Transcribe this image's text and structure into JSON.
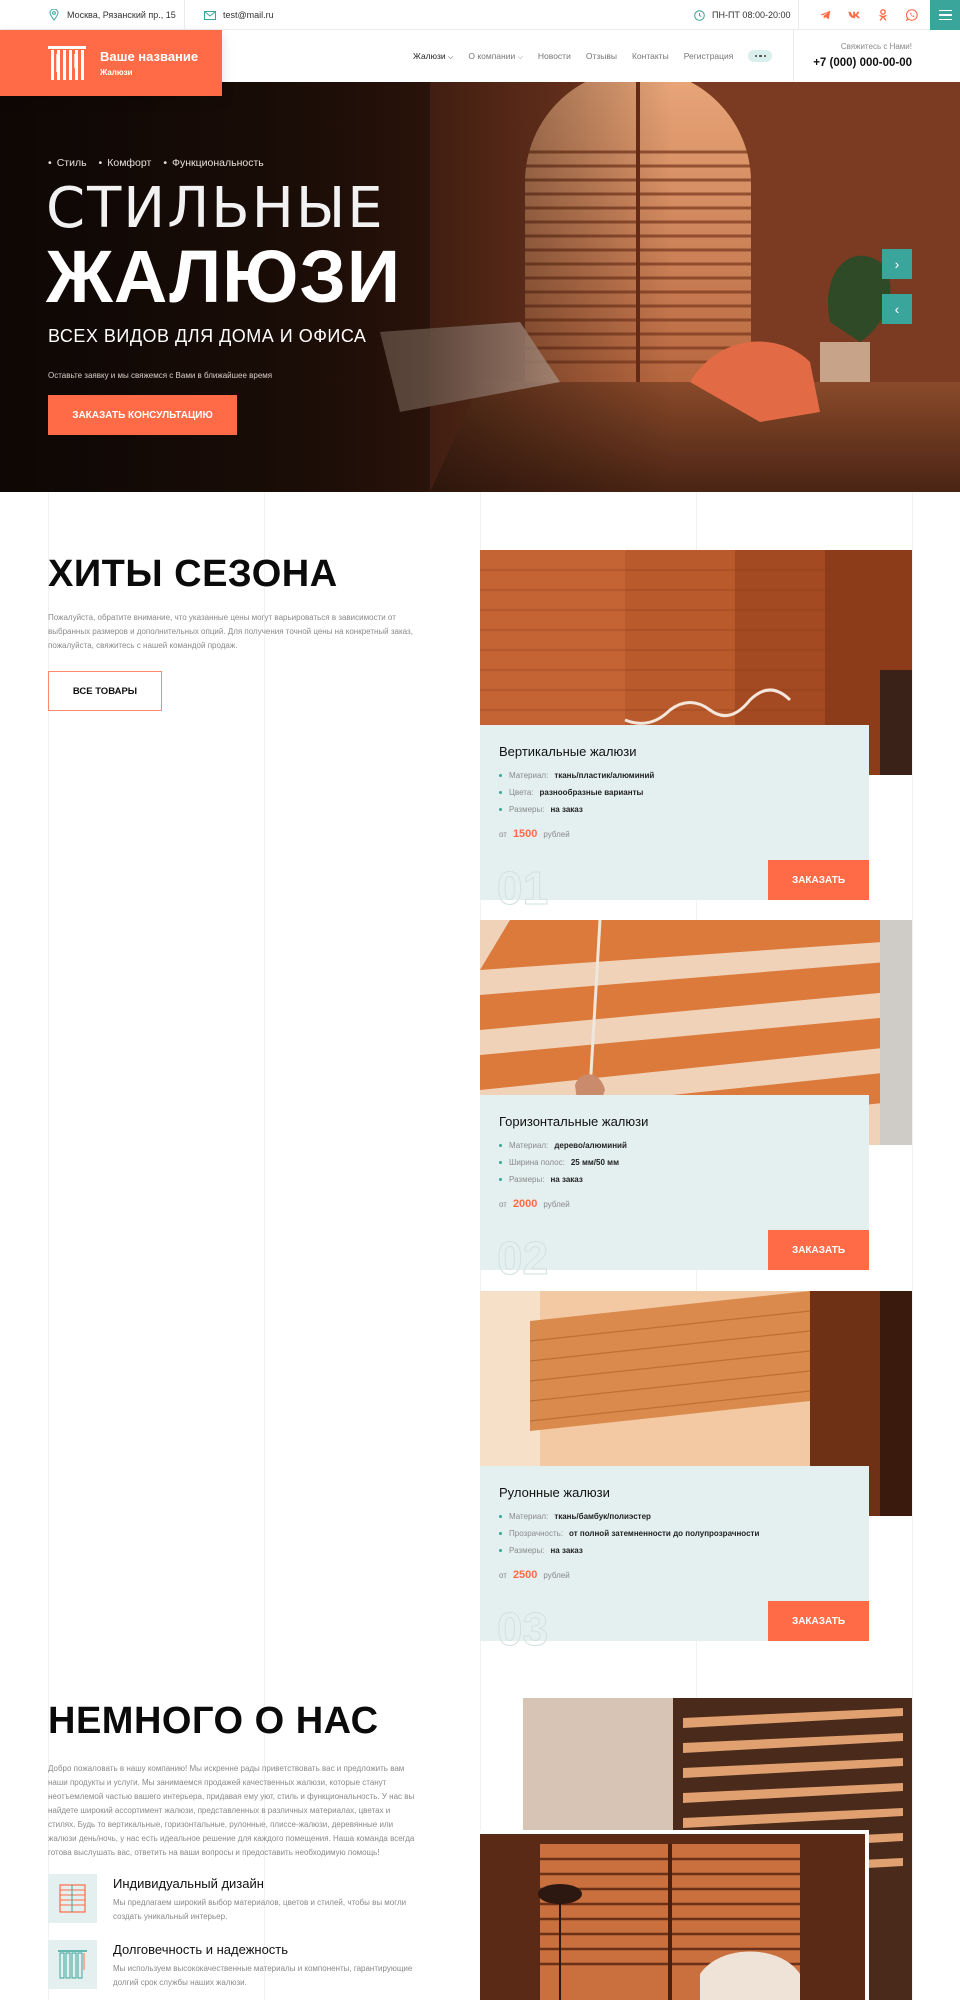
{
  "topbar": {
    "address": "Москва, Рязанский пр., 15",
    "email": "test@mail.ru",
    "hours": "ПН-ПТ 08:00-20:00",
    "socials": [
      "telegram-icon",
      "vk-icon",
      "odnoklassniki-icon",
      "whatsapp-icon"
    ]
  },
  "header": {
    "logo_title": "Ваше название",
    "logo_subtitle": "Жалюзи",
    "nav": [
      "Жалюзи",
      "О компании",
      "Новости",
      "Отзывы",
      "Контакты",
      "Регистрация"
    ],
    "callme": "Свяжитесь с Нами!",
    "phone": "+7 (000) 000-00-00"
  },
  "hero": {
    "tags": [
      "Стиль",
      "Комфорт",
      "Функциональность"
    ],
    "line1": "СТИЛЬНЫЕ",
    "line2": "ЖАЛЮЗИ",
    "line3": "ВСЕХ ВИДОВ ДЛЯ ДОМА И ОФИСА",
    "note": "Оставьте заявку и мы свяжемся с Вами в ближайшее время",
    "cta": "ЗАКАЗАТЬ КОНСУЛЬТАЦИЮ"
  },
  "hits": {
    "title": "ХИТЫ СЕЗОНА",
    "text": "Пожалуйста, обратите внимание, что указанные цены могут варьироваться в зависимости от выбранных размеров и дополнительных опций. Для получения точной цены на конкретный заказ, пожалуйста, свяжитесь с нашей командой продаж.",
    "all_button": "ВСЕ ТОВАРЫ",
    "price_prefix": "от",
    "price_suffix": "рублей",
    "order_button": "ЗАКАЗАТЬ",
    "products": [
      {
        "name": "Вертикальные жалюзи",
        "rows": [
          {
            "label": "Материал:",
            "value": "ткань/пластик/алюминий"
          },
          {
            "label": "Цвета:",
            "value": "разнообразные варианты"
          },
          {
            "label": "Размеры:",
            "value": "на заказ"
          }
        ],
        "price": "1500",
        "number": "01"
      },
      {
        "name": "Горизонтальные жалюзи",
        "rows": [
          {
            "label": "Материал:",
            "value": "дерево/алюминий"
          },
          {
            "label": "Ширина полос:",
            "value": "25 мм/50 мм"
          },
          {
            "label": "Размеры:",
            "value": "на заказ"
          }
        ],
        "price": "2000",
        "number": "02"
      },
      {
        "name": "Рулонные жалюзи",
        "rows": [
          {
            "label": "Материал:",
            "value": "ткань/бамбук/полиэстер"
          },
          {
            "label": "Прозрачность:",
            "value": "от полной затемненности до полупрозрачности"
          },
          {
            "label": "Размеры:",
            "value": "на заказ"
          }
        ],
        "price": "2500",
        "number": "03"
      }
    ]
  },
  "about": {
    "title": "НЕМНОГО О НАС",
    "text": "Добро пожаловать в нашу компанию! Мы искренне рады приветствовать вас и предложить вам наши продукты и услуги. Мы занимаемся продажей качественных жалюзи, которые станут неотъемлемой частью вашего интерьера, придавая ему уют, стиль и функциональность. У нас вы найдете широкий ассортимент жалюзи, представленных в различных материалах, цветах и стилях. Будь то вертикальные, горизонтальные, рулонные, плиссе-жалюзи, деревянные или жалюзи день/ночь, у нас есть идеальное решение для каждого помещения. Наша команда всегда готова выслушать вас, ответить на ваши вопросы и предоставить необходимую помощь!",
    "features": [
      {
        "title": "Индивидуальный дизайн",
        "text": "Мы предлагаем широкий выбор материалов, цветов и стилей, чтобы вы могли создать уникальный интерьер."
      },
      {
        "title": "Долговечность и надежность",
        "text": "Мы используем высококачественные материалы и компоненты, гарантирующие долгий срок службы наших жалюзи."
      }
    ]
  },
  "colors": {
    "accent": "#ff6a47",
    "teal": "#3aa59b",
    "card_bg": "#e4f0ef"
  }
}
